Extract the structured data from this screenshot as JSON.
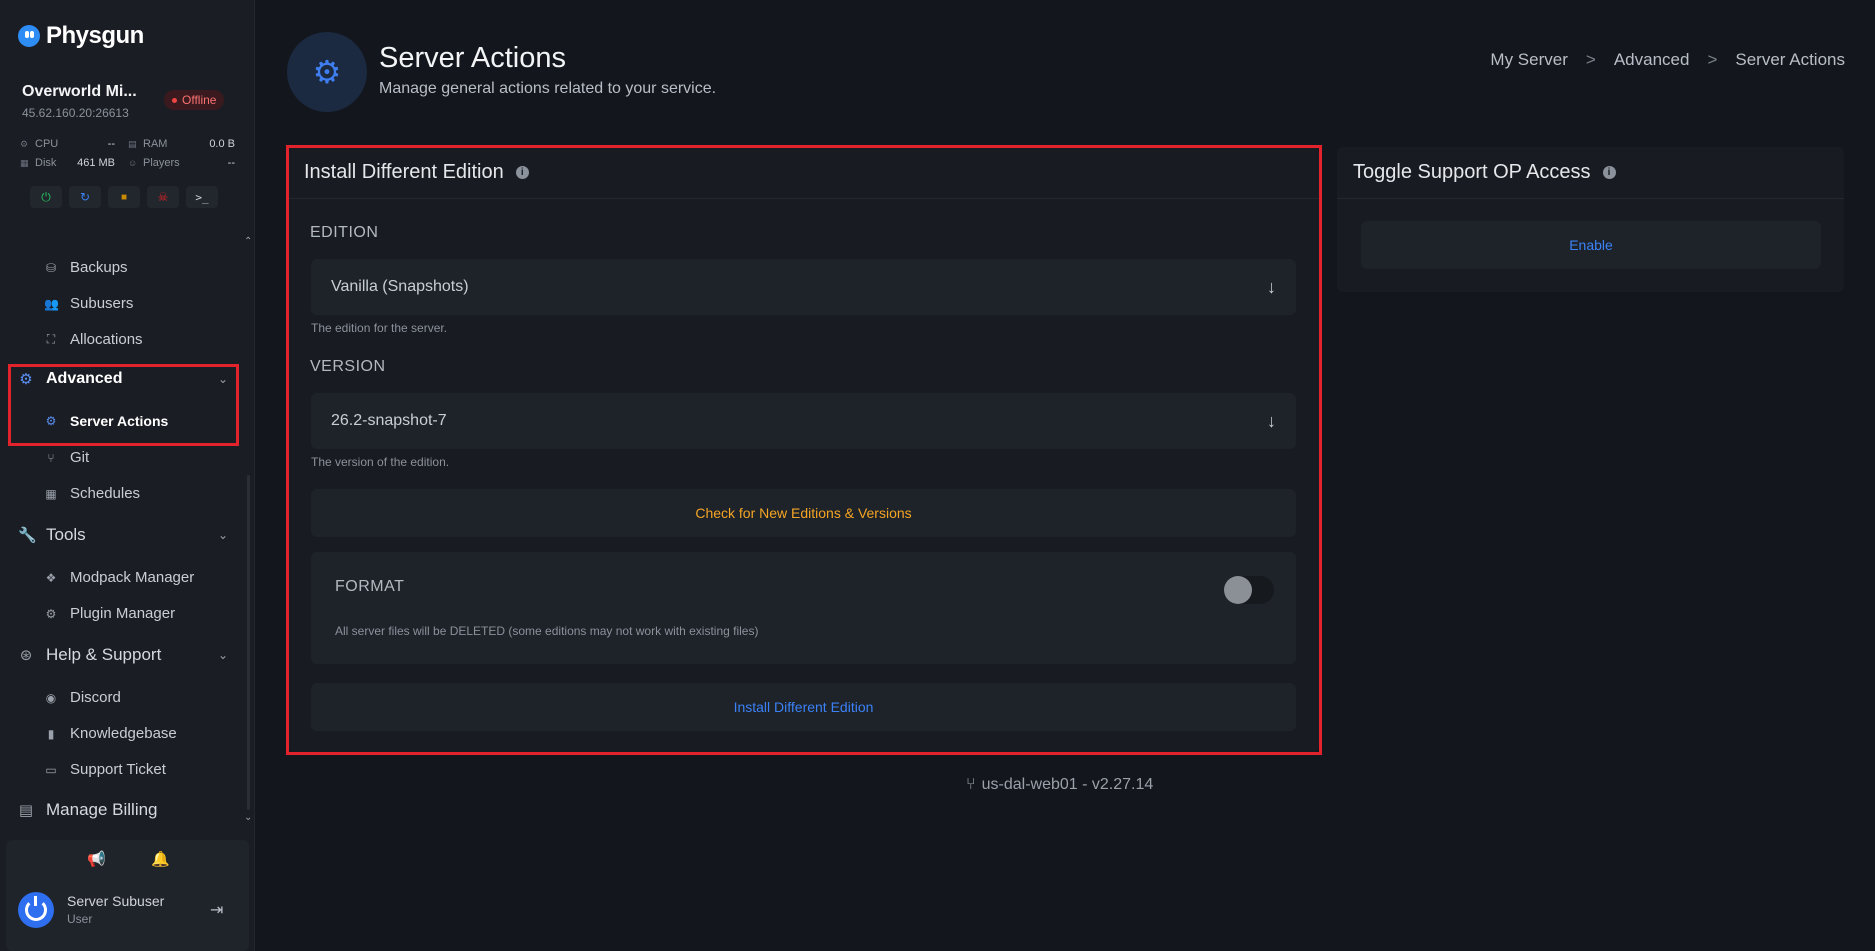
{
  "brand": {
    "name": "Physgun"
  },
  "server": {
    "name": "Overworld Mi...",
    "ip": "45.62.160.20:26613",
    "status": "Offline",
    "stats": {
      "cpu_label": "CPU",
      "cpu_value": "--",
      "ram_label": "RAM",
      "ram_value": "0.0 B",
      "disk_label": "Disk",
      "disk_value": "461 MB",
      "players_label": "Players",
      "players_value": "--"
    }
  },
  "controls": [
    "power-icon",
    "restart-icon",
    "stop-icon",
    "kill-icon",
    "console-icon"
  ],
  "sidebar": {
    "items": [
      {
        "label": "Backups",
        "icon": "backups-icon"
      },
      {
        "label": "Subusers",
        "icon": "users-icon"
      },
      {
        "label": "Allocations",
        "icon": "network-icon"
      }
    ],
    "advanced": {
      "label": "Advanced",
      "items": [
        {
          "label": "Server Actions",
          "icon": "cogs-icon"
        },
        {
          "label": "Git",
          "icon": "git-icon"
        },
        {
          "label": "Schedules",
          "icon": "calendar-icon"
        }
      ]
    },
    "tools": {
      "label": "Tools",
      "items": [
        {
          "label": "Modpack Manager",
          "icon": "cubes-icon"
        },
        {
          "label": "Plugin Manager",
          "icon": "cogs-icon"
        }
      ]
    },
    "help": {
      "label": "Help & Support",
      "items": [
        {
          "label": "Discord",
          "icon": "discord-icon"
        },
        {
          "label": "Knowledgebase",
          "icon": "book-icon"
        },
        {
          "label": "Support Ticket",
          "icon": "ticket-icon"
        }
      ]
    },
    "billing": {
      "label": "Manage Billing"
    }
  },
  "user": {
    "name": "Server Subuser",
    "role": "User"
  },
  "page": {
    "title": "Server Actions",
    "subtitle": "Manage general actions related to your service.",
    "breadcrumb": [
      "My Server",
      "Advanced",
      "Server Actions"
    ]
  },
  "install_card": {
    "title": "Install Different Edition",
    "edition_label": "EDITION",
    "edition_value": "Vanilla (Snapshots)",
    "edition_hint": "The edition for the server.",
    "version_label": "VERSION",
    "version_value": "26.2-snapshot-7",
    "version_hint": "The version of the edition.",
    "check_button": "Check for New Editions & Versions",
    "format_label": "FORMAT",
    "format_hint": "All server files will be DELETED (some editions may not work with existing files)",
    "format_enabled": false,
    "install_button": "Install Different Edition"
  },
  "op_card": {
    "title": "Toggle Support OP Access",
    "enable_button": "Enable"
  },
  "footer": {
    "version": "us-dal-web01 - v2.27.14"
  },
  "colors": {
    "accent": "#3f7ef0",
    "warning": "#f5a524",
    "danger": "#e2232b",
    "offline": "#f87171"
  }
}
